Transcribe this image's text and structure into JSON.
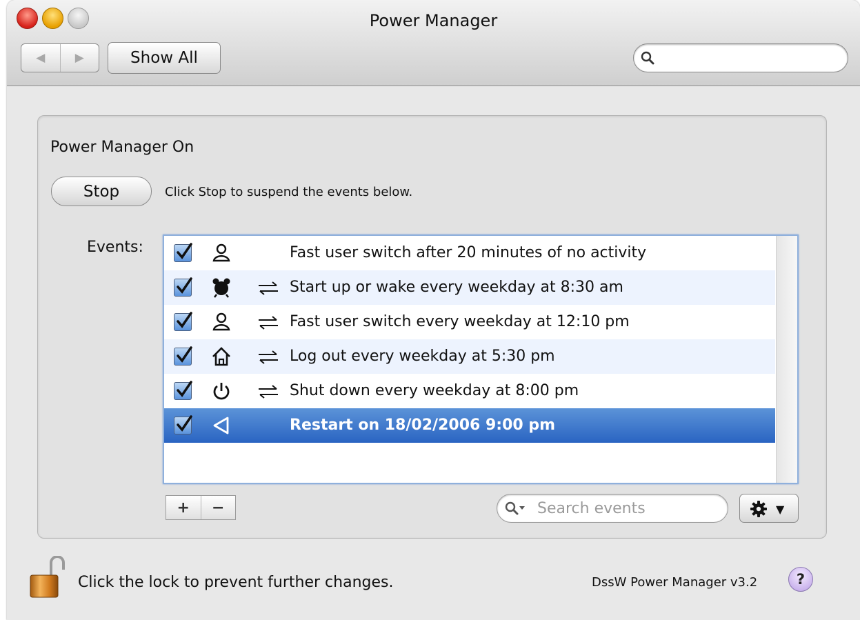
{
  "window": {
    "title": "Power Manager"
  },
  "toolbar": {
    "back_label": "◀",
    "forward_label": "▶",
    "show_all_label": "Show All",
    "search_placeholder": ""
  },
  "panel": {
    "status_title": "Power Manager On",
    "stop_label": "Stop",
    "stop_hint": "Click Stop to suspend the events below.",
    "events_label": "Events:",
    "events": [
      {
        "checked": true,
        "icon": "user-switch-icon",
        "repeats": false,
        "text": "Fast user switch after 20 minutes of no activity"
      },
      {
        "checked": true,
        "icon": "alarm-clock-icon",
        "repeats": true,
        "text": "Start up or wake every weekday at 8:30 am"
      },
      {
        "checked": true,
        "icon": "user-switch-icon",
        "repeats": true,
        "text": "Fast user switch every weekday at 12:10 pm"
      },
      {
        "checked": true,
        "icon": "home-icon",
        "repeats": true,
        "text": "Log out every weekday at 5:30 pm"
      },
      {
        "checked": true,
        "icon": "power-icon",
        "repeats": true,
        "text": "Shut down every weekday at 8:00 pm"
      },
      {
        "checked": true,
        "icon": "restart-arrow-icon",
        "repeats": false,
        "text": "Restart on 18/02/2006 9:00 pm",
        "selected": true
      }
    ],
    "add_label": "+",
    "remove_label": "−",
    "search_placeholder": "Search events",
    "gear_arrow": "▼"
  },
  "footer": {
    "lock_text": "Click the lock to prevent further changes.",
    "version": "DssW Power Manager v3.2",
    "help_label": "?"
  },
  "colors": {
    "selection": "#2a64c2",
    "alt_row": "#edf3fe",
    "list_border": "#8fb0dc"
  }
}
